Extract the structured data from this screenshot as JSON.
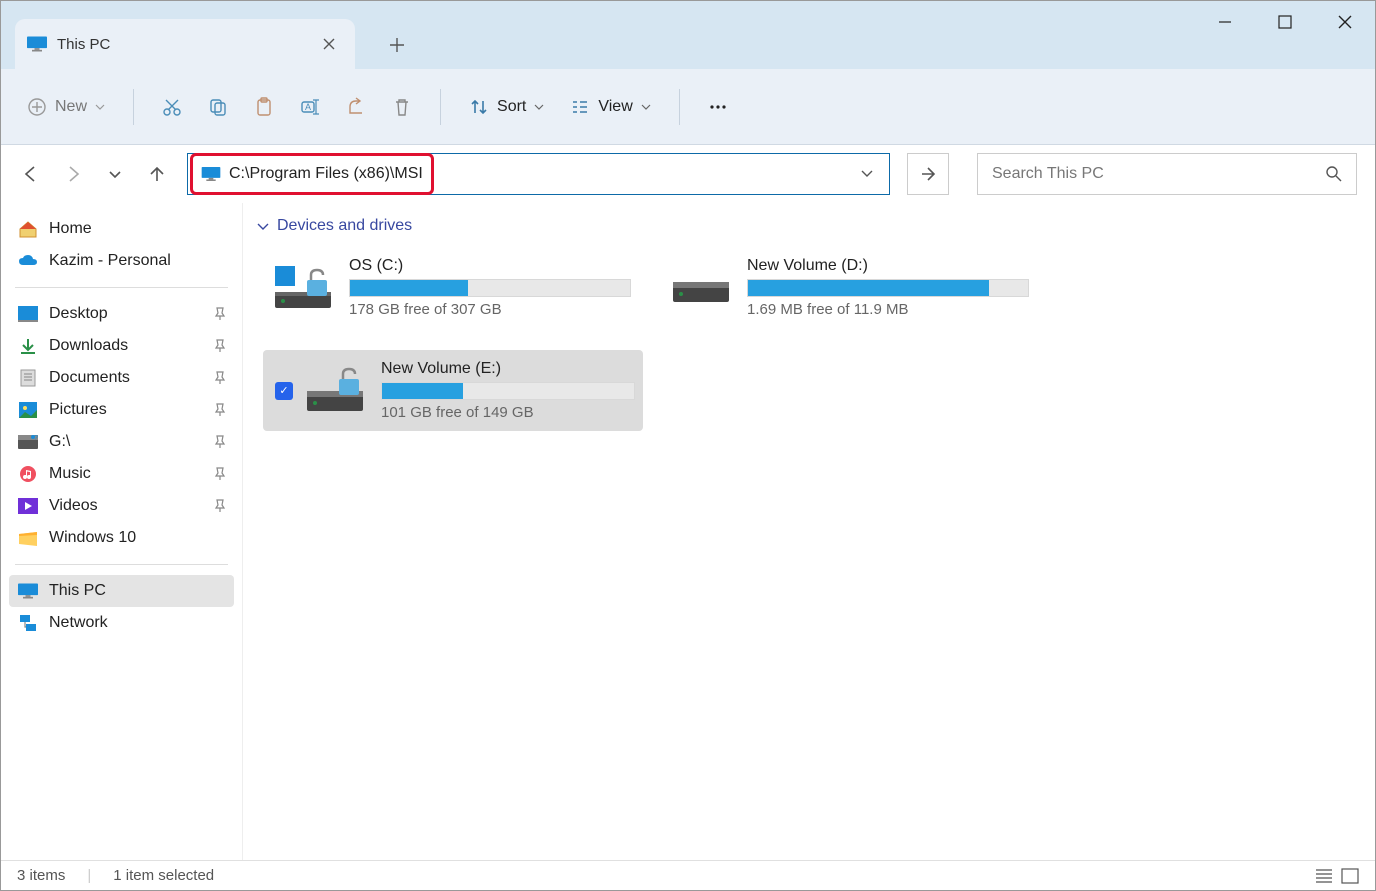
{
  "tab": {
    "title": "This PC"
  },
  "toolbar": {
    "new_label": "New",
    "sort_label": "Sort",
    "view_label": "View"
  },
  "address": {
    "path": "C:\\Program Files (x86)\\MSI"
  },
  "search": {
    "placeholder": "Search This PC"
  },
  "sidebar": {
    "home": "Home",
    "onedrive": "Kazim - Personal",
    "quick": [
      {
        "label": "Desktop"
      },
      {
        "label": "Downloads"
      },
      {
        "label": "Documents"
      },
      {
        "label": "Pictures"
      },
      {
        "label": "G:\\"
      },
      {
        "label": "Music"
      },
      {
        "label": "Videos"
      },
      {
        "label": "Windows 10"
      }
    ],
    "this_pc": "This PC",
    "network": "Network"
  },
  "section_header": "Devices and drives",
  "drives": [
    {
      "name": "OS (C:)",
      "free": "178 GB free of 307 GB",
      "fill_pct": 42,
      "os": true
    },
    {
      "name": "New Volume (D:)",
      "free": "1.69 MB free of 11.9 MB",
      "fill_pct": 86
    },
    {
      "name": "New Volume (E:)",
      "free": "101 GB free of 149 GB",
      "fill_pct": 32,
      "selected": true
    }
  ],
  "status": {
    "items": "3 items",
    "selected": "1 item selected"
  }
}
